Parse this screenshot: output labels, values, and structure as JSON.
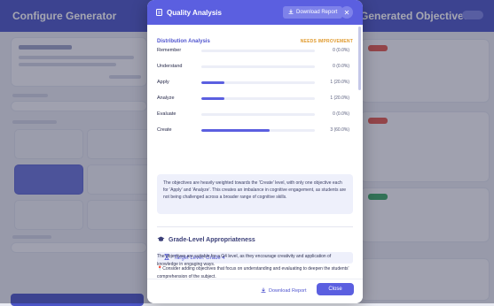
{
  "background": {
    "left_title": "Configure Generator",
    "right_title": "Generated Objectives"
  },
  "modal": {
    "title": "Quality Analysis",
    "download_label": "Download Report",
    "close_icon": "close-icon",
    "distribution": {
      "title": "Distribution Analysis",
      "status": "NEEDS IMPROVEMENT",
      "status_color": "#e09a2d",
      "rows": [
        {
          "label": "Remember",
          "value": "0 (0.0%)",
          "fraction": 0.0
        },
        {
          "label": "Understand",
          "value": "0 (0.0%)",
          "fraction": 0.0
        },
        {
          "label": "Apply",
          "value": "1 (20.0%)",
          "fraction": 0.2
        },
        {
          "label": "Analyze",
          "value": "1 (20.0%)",
          "fraction": 0.2
        },
        {
          "label": "Evaluate",
          "value": "0 (0.0%)",
          "fraction": 0.0
        },
        {
          "label": "Create",
          "value": "3 (60.0%)",
          "fraction": 0.6
        }
      ],
      "note": "The objectives are heavily weighted towards the 'Create' level, with only one objective each for 'Apply' and 'Analyze'. This creates an imbalance in cognitive engagement, as students are not being challenged across a broader range of cognitive skills."
    },
    "grade_level": {
      "title": "Grade-Level Appropriateness",
      "target": "Target Level: Grade 4",
      "paragraph": "The objectives are suitable for a G4 level, as they encourage creativity and application of knowledge in engaging ways.",
      "suggestion": "Consider adding objectives that focus on understanding and evaluating to deepen the students' comprehension of the subject."
    },
    "footer": {
      "download_label": "Download Report",
      "close_label": "Close"
    }
  },
  "colors": {
    "accent": "#5b5fe0",
    "header_bg": "#4b55c7"
  }
}
